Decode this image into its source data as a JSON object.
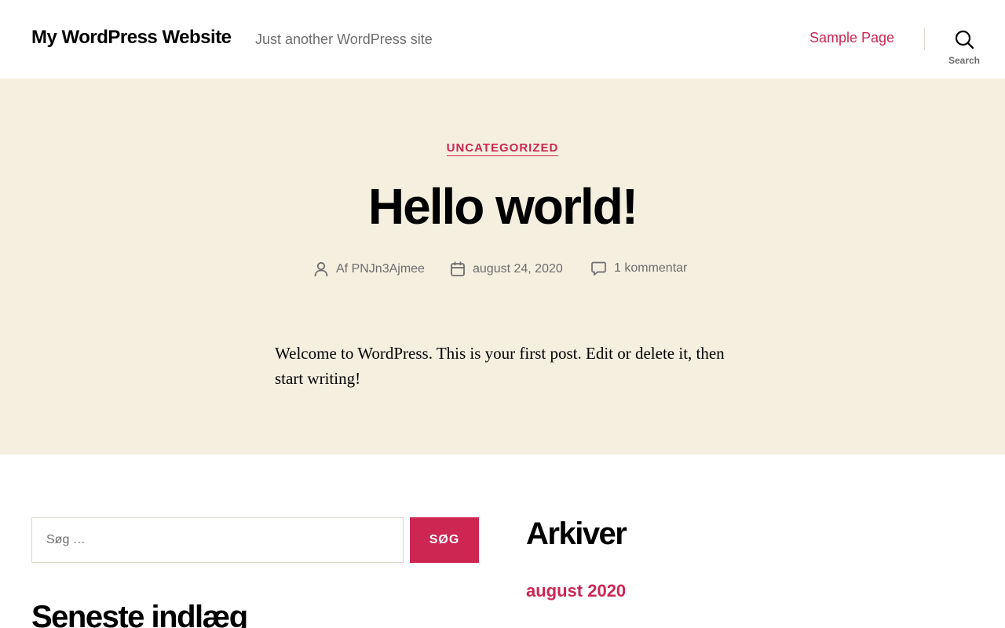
{
  "header": {
    "site_title": "My WordPress Website",
    "site_description": "Just another WordPress site",
    "nav": [
      {
        "label": "Sample Page"
      }
    ],
    "search_label": "Search"
  },
  "post": {
    "category": "UNCATEGORIZED",
    "title": "Hello world!",
    "author": "Af PNJn3Ajmee",
    "date": "august 24, 2020",
    "comments": "1 kommentar",
    "content": "Welcome to WordPress. This is your first post. Edit or delete it, then start writing!"
  },
  "widgets": {
    "search": {
      "placeholder": "Søg …",
      "button_label": "SØG"
    },
    "recent_title": "Seneste indlæg",
    "archives_title": "Arkiver",
    "archives": [
      {
        "label": "august 2020"
      }
    ]
  },
  "colors": {
    "accent": "#cd2653",
    "hero_bg": "#f5efe0",
    "muted_text": "#6d6d6d"
  },
  "icons": [
    "search-icon",
    "user-icon",
    "calendar-icon",
    "comment-icon"
  ]
}
